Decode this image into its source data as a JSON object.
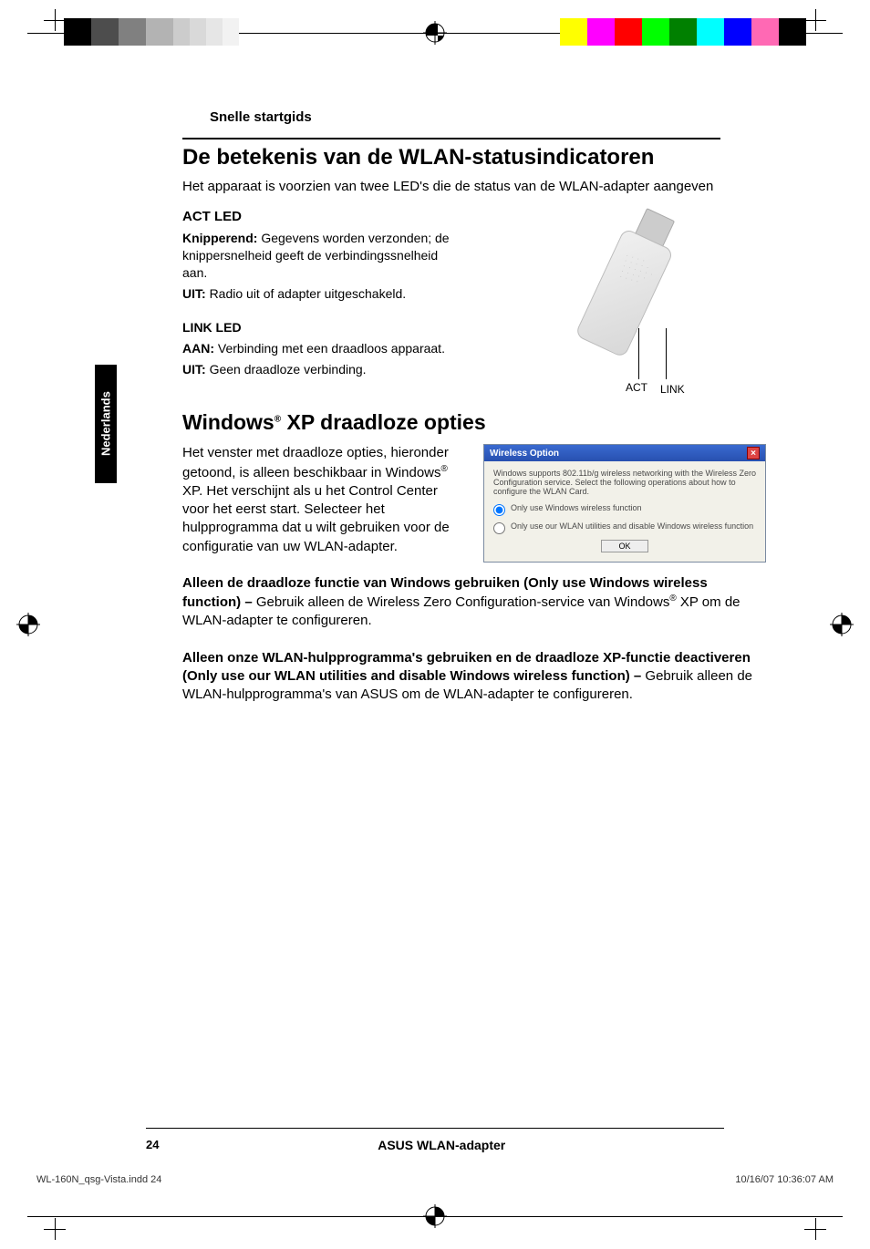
{
  "header": {
    "title": "Snelle startgids"
  },
  "section1": {
    "heading": "De betekenis van de WLAN-statusindicatoren",
    "intro": "Het apparaat is voorzien van twee LED's die de status van de WLAN-adapter aangeven",
    "act": {
      "title": "ACT LED",
      "blink_label": "Knipperend:",
      "blink_text": "Gegevens worden verzonden; de knippersnelheid geeft de verbindingssnelheid aan.",
      "off_label": "UIT:",
      "off_text": "Radio uit of adapter uitgeschakeld."
    },
    "link": {
      "title": "LINK LED",
      "on_label": "AAN:",
      "on_text": "Verbinding met een draadloos apparaat.",
      "off_label": "UIT:",
      "off_text": "Geen draadloze verbinding."
    },
    "diagram": {
      "act": "ACT",
      "link": "LINK"
    }
  },
  "section2": {
    "heading_pre": "Windows",
    "heading_sup": "®",
    "heading_post": " XP draadloze opties",
    "intro_pre": "Het venster met draadloze opties, hieronder getoond, is alleen beschikbaar in Windows",
    "intro_sup": "®",
    "intro_post": " XP. Het verschijnt als u het Control Center voor het eerst start. Selecteer het hulpprogramma dat u wilt gebruiken voor de configuratie van uw WLAN-adapter.",
    "dialog": {
      "title": "Wireless Option",
      "desc": "Windows supports 802.11b/g wireless networking with the Wireless Zero Configuration service. Select the following operations about how to configure the WLAN Card.",
      "opt1": "Only use Windows wireless function",
      "opt2": "Only use our WLAN utilities and disable Windows wireless function",
      "ok": "OK"
    },
    "optA_bold": "Alleen de draadloze functie van Windows gebruiken (Only use Windows wireless function) – ",
    "optA_text_pre": "Gebruik alleen de Wireless Zero Configuration-service van Windows",
    "optA_sup": "®",
    "optA_text_post": " XP om de WLAN-adapter te configureren.",
    "optB_bold": "Alleen onze WLAN-hulpprogramma's gebruiken en de draadloze XP-functie deactiveren (Only use our WLAN utilities and disable Windows wireless function) – ",
    "optB_text": "Gebruik alleen de WLAN-hulpprogramma's van ASUS om de WLAN-adapter te configureren."
  },
  "sidebar": {
    "lang": "Nederlands"
  },
  "footer": {
    "page": "24",
    "product": "ASUS WLAN-adapter"
  },
  "job": {
    "file": "WL-160N_qsg-Vista.indd   24",
    "stamp": "10/16/07   10:36:07 AM"
  }
}
